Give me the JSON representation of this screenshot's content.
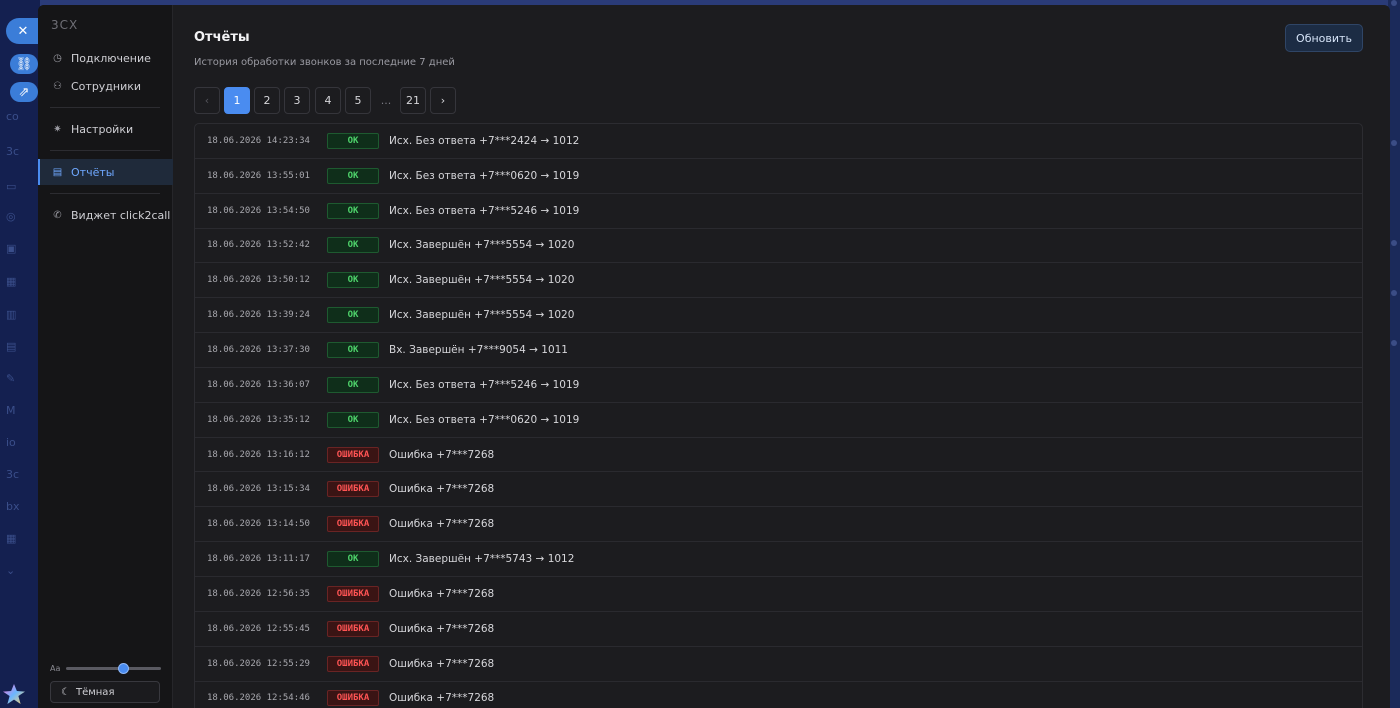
{
  "sidebar": {
    "brand": "3CX",
    "items": [
      {
        "label": "Подключение",
        "icon": "clock-icon",
        "active": false
      },
      {
        "label": "Сотрудники",
        "icon": "users-icon",
        "active": false
      },
      {
        "label": "Настройки",
        "icon": "gear-icon",
        "active": false
      },
      {
        "label": "Отчёты",
        "icon": "report-icon",
        "active": true
      },
      {
        "label": "Виджет click2call",
        "icon": "phone-icon",
        "active": false
      }
    ],
    "font_size_label": "Aa",
    "font_size_level": 0.6,
    "theme_label": "Тёмная"
  },
  "header": {
    "title": "Отчёты",
    "subtitle": "История обработки звонков за последние 7 дней",
    "refresh_label": "Обновить"
  },
  "pager": {
    "prev": "‹",
    "next": "›",
    "pages": [
      "1",
      "2",
      "3",
      "4",
      "5"
    ],
    "ellipsis": "...",
    "last": "21",
    "current": "1"
  },
  "log": [
    {
      "ts": "18.06.2026 14:23:34",
      "status": "OK",
      "msg": "Исх. Без ответа +7***2424 → 1012"
    },
    {
      "ts": "18.06.2026 13:55:01",
      "status": "OK",
      "msg": "Исх. Без ответа +7***0620 → 1019"
    },
    {
      "ts": "18.06.2026 13:54:50",
      "status": "OK",
      "msg": "Исх. Без ответа +7***5246 → 1019"
    },
    {
      "ts": "18.06.2026 13:52:42",
      "status": "OK",
      "msg": "Исх. Завершён +7***5554 → 1020"
    },
    {
      "ts": "18.06.2026 13:50:12",
      "status": "OK",
      "msg": "Исх. Завершён +7***5554 → 1020"
    },
    {
      "ts": "18.06.2026 13:39:24",
      "status": "OK",
      "msg": "Исх. Завершён +7***5554 → 1020"
    },
    {
      "ts": "18.06.2026 13:37:30",
      "status": "OK",
      "msg": "Вх. Завершён +7***9054 → 1011"
    },
    {
      "ts": "18.06.2026 13:36:07",
      "status": "OK",
      "msg": "Исх. Без ответа +7***5246 → 1019"
    },
    {
      "ts": "18.06.2026 13:35:12",
      "status": "OK",
      "msg": "Исх. Без ответа +7***0620 → 1019"
    },
    {
      "ts": "18.06.2026 13:16:12",
      "status": "ОШИБКА",
      "msg": "Ошибка +7***7268"
    },
    {
      "ts": "18.06.2026 13:15:34",
      "status": "ОШИБКА",
      "msg": "Ошибка +7***7268"
    },
    {
      "ts": "18.06.2026 13:14:50",
      "status": "ОШИБКА",
      "msg": "Ошибка +7***7268"
    },
    {
      "ts": "18.06.2026 13:11:17",
      "status": "OK",
      "msg": "Исх. Завершён +7***5743 → 1012"
    },
    {
      "ts": "18.06.2026 12:56:35",
      "status": "ОШИБКА",
      "msg": "Ошибка +7***7268"
    },
    {
      "ts": "18.06.2026 12:55:45",
      "status": "ОШИБКА",
      "msg": "Ошибка +7***7268"
    },
    {
      "ts": "18.06.2026 12:55:29",
      "status": "ОШИБКА",
      "msg": "Ошибка +7***7268"
    },
    {
      "ts": "18.06.2026 12:54:46",
      "status": "ОШИБКА",
      "msg": "Ошибка +7***7268"
    }
  ],
  "colors": {
    "accent": "#4a8cf0",
    "ok": "#4ed36b",
    "error": "#ff5454"
  }
}
